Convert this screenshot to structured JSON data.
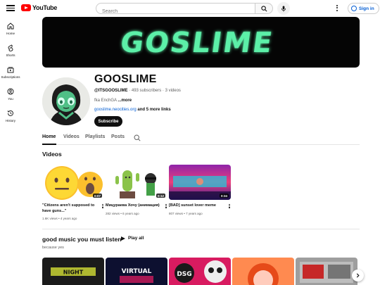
{
  "header": {
    "logo_text": "YouTube",
    "search_placeholder": "Search",
    "signin_label": "Sign in"
  },
  "sidebar": {
    "items": [
      {
        "label": "Home",
        "icon": "home-icon"
      },
      {
        "label": "Shorts",
        "icon": "shorts-icon"
      },
      {
        "label": "Subscriptions",
        "icon": "subscriptions-icon"
      },
      {
        "label": "You",
        "icon": "you-icon"
      },
      {
        "label": "History",
        "icon": "history-icon"
      }
    ]
  },
  "banner": {
    "text": "GOSLIME",
    "color": "#5cf0a8"
  },
  "channel": {
    "name": "GOOSLIME",
    "handle": "@ITSGOOSLIME",
    "subscribers": "493 subscribers",
    "videos": "3 videos",
    "description": "fka EnchGA",
    "more_label": "...more",
    "link": "gooslime.neocities.org",
    "more_links": "and 5 more links",
    "subscribe_label": "Subscribe"
  },
  "tabs": [
    {
      "label": "Home",
      "active": true
    },
    {
      "label": "Videos",
      "active": false
    },
    {
      "label": "Playlists",
      "active": false
    },
    {
      "label": "Posts",
      "active": false
    }
  ],
  "videos_section": {
    "title": "Videos",
    "items": [
      {
        "title": "\"Citizens aren't supposed to have guns...\"",
        "views": "1.6K views",
        "age": "4 years ago",
        "duration": "0:07"
      },
      {
        "title": "Мицураева Хочу (анимация)",
        "views": "282 views",
        "age": "6 years ago",
        "duration": "0:12"
      },
      {
        "title": "[BAD] sunset lover meme",
        "views": "807 views",
        "age": "7 years ago",
        "duration": "0:34"
      }
    ]
  },
  "playlist_section": {
    "title": "good music you must listen",
    "play_all_label": "Play all",
    "subtitle": "because yes",
    "thumb_texts": [
      "NIGHT",
      "VIRTUAL",
      "DSG"
    ]
  }
}
